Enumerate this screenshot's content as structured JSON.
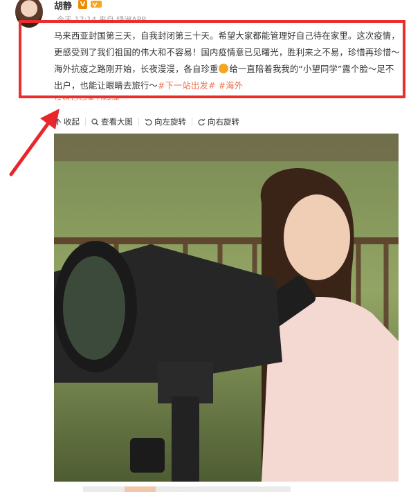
{
  "user": {
    "name": "胡静",
    "vip_mark": "V"
  },
  "meta": {
    "time": "今天 17:14 来自 绿洲APP"
  },
  "post": {
    "text_before_emoji": "马来西亚封国第三天，自我封闭第三十天。希望大家都能管理好自己待在家里。这次疫情，更感受到了我们祖国的伟大和不容易！国内疫情意已见曙光，胜利来之不易，珍惜再珍惜～海外抗疫之路刚开始，长夜漫漫，各自珍重",
    "text_after_emoji": "给一直陪着我我的“小望同学”露个脸～足不出户，也能让眼睛去旅行～",
    "tag1": "#下一站出发#",
    "tag2": "#海外",
    "cut_line": "抗疫日记#  ♀绿洲"
  },
  "toolbar": {
    "collapse": "收起",
    "view_large": "查看大图",
    "rotate_left": "向左旋转",
    "rotate_right": "向右旋转"
  },
  "colors": {
    "highlight_border": "#ea2d2d",
    "tag": "#eb7350",
    "arrow": "#e8262c"
  }
}
